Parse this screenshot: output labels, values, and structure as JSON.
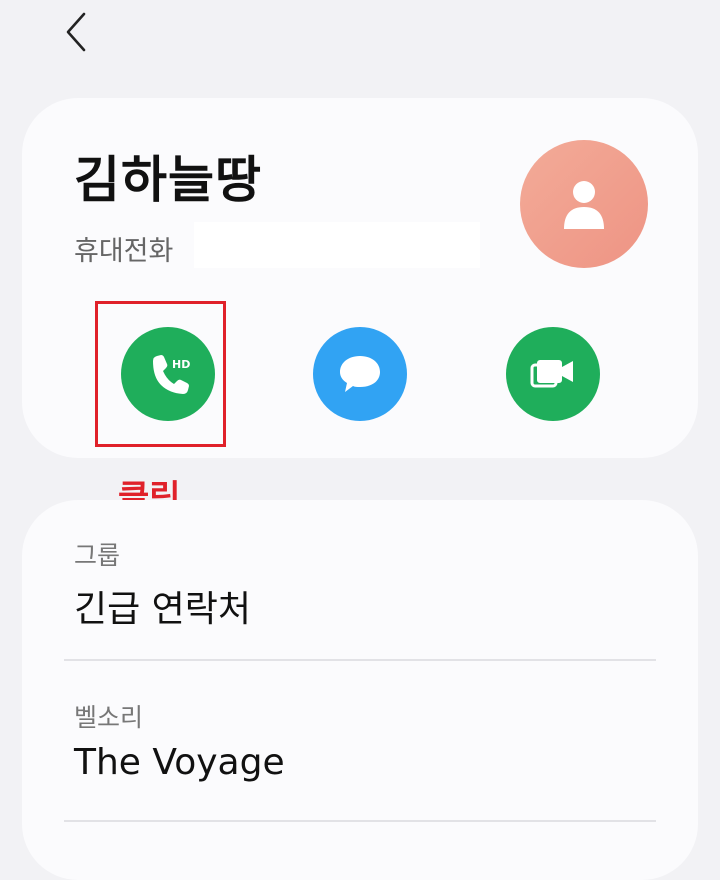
{
  "header": {
    "back_icon": "chevron-left-icon"
  },
  "contact": {
    "name": "김하늘땅",
    "phone_label": "휴대전화",
    "avatar_icon": "person-icon",
    "avatar_color": "#f0a090"
  },
  "actions": [
    {
      "icon": "phone-hd-icon",
      "badge": "HD",
      "color": "#1fae5b"
    },
    {
      "icon": "message-icon",
      "color": "#31a3f3"
    },
    {
      "icon": "video-call-icon",
      "color": "#1fae5b"
    }
  ],
  "annotation": {
    "text": "클릭",
    "color": "#e0212a"
  },
  "details": {
    "group": {
      "label": "그룹",
      "value": "긴급 연락처"
    },
    "ringtone": {
      "label": "벨소리",
      "value": "The Voyage"
    }
  }
}
